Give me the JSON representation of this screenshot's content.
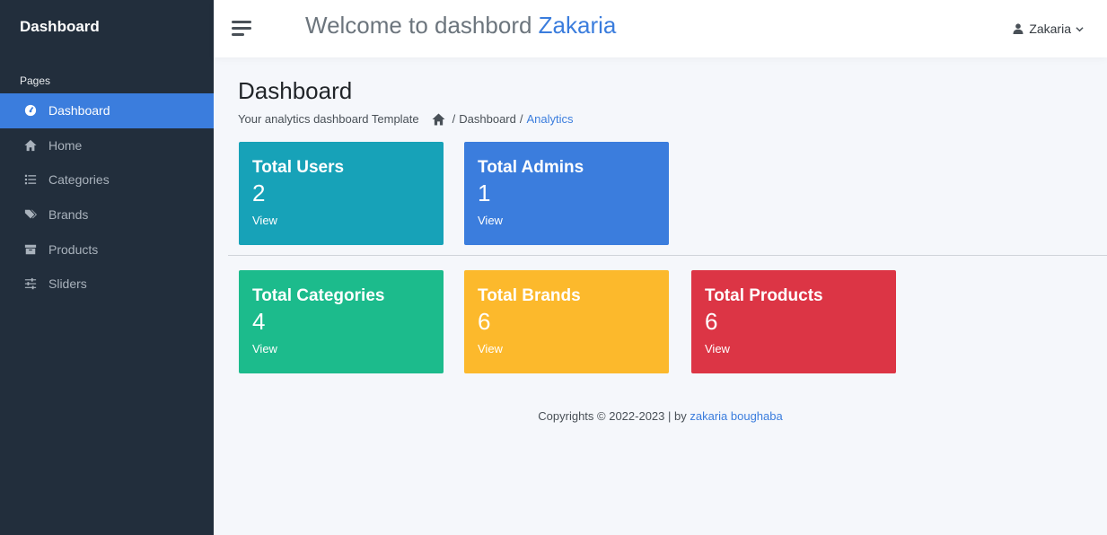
{
  "sidebar": {
    "brand": "Dashboard",
    "section_header": "Pages",
    "items": [
      {
        "label": "Dashboard",
        "icon": "gauge-icon",
        "active": true
      },
      {
        "label": "Home",
        "icon": "home-icon"
      },
      {
        "label": "Categories",
        "icon": "list-icon"
      },
      {
        "label": "Brands",
        "icon": "tags-icon"
      },
      {
        "label": "Products",
        "icon": "archive-icon"
      },
      {
        "label": "Sliders",
        "icon": "sliders-icon"
      }
    ]
  },
  "topbar": {
    "welcome_prefix": "Welcome to dashbord",
    "welcome_name": "Zakaria",
    "user_name": "Zakaria"
  },
  "main": {
    "page_title": "Dashboard",
    "subtitle": "Your analytics dashboard Template",
    "breadcrumb": {
      "sep": "/",
      "item1": "Dashboard",
      "active": "Analytics"
    },
    "cards": [
      {
        "title": "Total Users",
        "count": "2",
        "link": "View",
        "color": "#17a2b8"
      },
      {
        "title": "Total Admins",
        "count": "1",
        "link": "View",
        "color": "#3b7ddd"
      },
      {
        "title": "Total Categories",
        "count": "4",
        "link": "View",
        "color": "#1cbb8c"
      },
      {
        "title": "Total Brands",
        "count": "6",
        "link": "View",
        "color": "#fcb92c"
      },
      {
        "title": "Total Products",
        "count": "6",
        "link": "View",
        "color": "#dc3545"
      }
    ]
  },
  "footer": {
    "text": "Copyrights © 2022-2023 | by",
    "author": "zakaria boughaba"
  },
  "colors": {
    "sidebar_bg": "#222e3c",
    "accent": "#3b7ddd",
    "page_bg": "#f5f7fb"
  }
}
